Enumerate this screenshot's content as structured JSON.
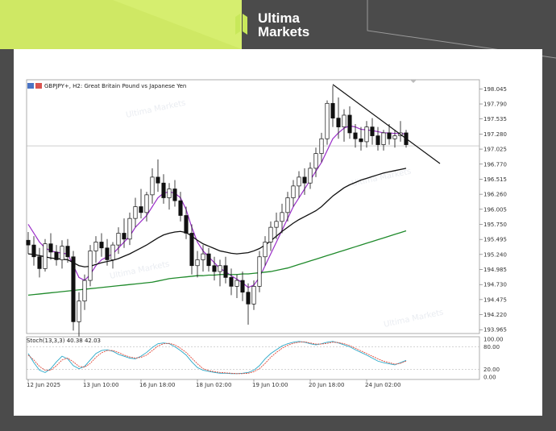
{
  "brand": {
    "line1": "Ultima",
    "line2": "Markets",
    "accent": "#d4f06a"
  },
  "chart_data": {
    "type": "candlestick",
    "symbol_title": "GBPJPY+, H2:  Great Britain Pound vs Japanese Yen",
    "indicator_title": "Stoch(13,3,3) 40.38 42.03",
    "price_axis": [
      "198.045",
      "197.790",
      "197.535",
      "197.280",
      "197.025",
      "196.770",
      "196.515",
      "196.260",
      "196.005",
      "195.750",
      "195.495",
      "195.240",
      "194.985",
      "194.730",
      "194.475",
      "194.220",
      "193.965"
    ],
    "stoch_axis": [
      "100.00",
      "80.00",
      "20.00",
      "0.00"
    ],
    "x_labels": [
      "12 Jun 2025",
      "13 Jun 10:00",
      "16 Jun 18:00",
      "18 Jun 02:00",
      "19 Jun 10:00",
      "20 Jun 18:00",
      "24 Jun 02:00"
    ],
    "ylim": [
      193.9,
      198.2
    ],
    "current_price": 197.08,
    "candles": [
      [
        195.48,
        195.62,
        195.25,
        195.4
      ],
      [
        195.4,
        195.55,
        195.05,
        195.2
      ],
      [
        195.2,
        195.35,
        194.85,
        195.0
      ],
      [
        195.0,
        195.5,
        194.95,
        195.42
      ],
      [
        195.42,
        195.6,
        195.15,
        195.28
      ],
      [
        195.28,
        195.4,
        195.05,
        195.15
      ],
      [
        195.15,
        195.48,
        195.0,
        195.38
      ],
      [
        195.38,
        195.5,
        195.1,
        195.2
      ],
      [
        195.2,
        195.3,
        193.95,
        194.1
      ],
      [
        194.1,
        194.6,
        193.85,
        194.45
      ],
      [
        194.45,
        194.9,
        194.3,
        194.8
      ],
      [
        194.8,
        195.4,
        194.7,
        195.3
      ],
      [
        195.3,
        195.55,
        195.1,
        195.45
      ],
      [
        195.45,
        195.6,
        195.2,
        195.35
      ],
      [
        195.35,
        195.5,
        195.05,
        195.15
      ],
      [
        195.15,
        195.45,
        195.0,
        195.4
      ],
      [
        195.4,
        195.7,
        195.25,
        195.6
      ],
      [
        195.6,
        195.85,
        195.35,
        195.5
      ],
      [
        195.5,
        195.95,
        195.4,
        195.85
      ],
      [
        195.85,
        196.2,
        195.7,
        196.05
      ],
      [
        196.05,
        196.35,
        195.85,
        195.95
      ],
      [
        195.95,
        196.3,
        195.8,
        196.25
      ],
      [
        196.25,
        196.7,
        196.1,
        196.55
      ],
      [
        196.55,
        196.85,
        196.3,
        196.45
      ],
      [
        196.45,
        196.6,
        196.1,
        196.2
      ],
      [
        196.2,
        196.45,
        196.0,
        196.35
      ],
      [
        196.35,
        196.5,
        196.05,
        196.15
      ],
      [
        196.15,
        196.3,
        195.8,
        195.9
      ],
      [
        195.9,
        196.05,
        195.5,
        195.6
      ],
      [
        195.6,
        195.75,
        194.9,
        195.05
      ],
      [
        195.05,
        195.3,
        194.85,
        195.15
      ],
      [
        195.15,
        195.4,
        194.95,
        195.25
      ],
      [
        195.25,
        195.35,
        194.95,
        195.05
      ],
      [
        195.05,
        195.2,
        194.8,
        194.95
      ],
      [
        194.95,
        195.15,
        194.7,
        195.05
      ],
      [
        195.05,
        195.2,
        194.75,
        194.85
      ],
      [
        194.85,
        195.0,
        194.55,
        194.7
      ],
      [
        194.7,
        194.9,
        194.5,
        194.8
      ],
      [
        194.8,
        194.95,
        194.45,
        194.6
      ],
      [
        194.6,
        194.75,
        194.05,
        194.4
      ],
      [
        194.4,
        194.8,
        194.3,
        194.7
      ],
      [
        194.7,
        195.3,
        194.6,
        195.2
      ],
      [
        195.2,
        195.55,
        195.05,
        195.45
      ],
      [
        195.45,
        195.8,
        195.3,
        195.7
      ],
      [
        195.7,
        195.95,
        195.5,
        195.8
      ],
      [
        195.8,
        196.1,
        195.6,
        195.95
      ],
      [
        195.95,
        196.3,
        195.8,
        196.2
      ],
      [
        196.2,
        196.5,
        196.05,
        196.4
      ],
      [
        196.4,
        196.65,
        196.2,
        196.55
      ],
      [
        196.55,
        196.7,
        196.25,
        196.45
      ],
      [
        196.45,
        196.8,
        196.35,
        196.7
      ],
      [
        196.7,
        197.05,
        196.55,
        196.95
      ],
      [
        196.95,
        197.3,
        196.8,
        197.2
      ],
      [
        197.2,
        197.85,
        197.1,
        197.8
      ],
      [
        197.8,
        198.1,
        197.4,
        197.55
      ],
      [
        197.55,
        197.9,
        197.2,
        197.4
      ],
      [
        197.4,
        197.7,
        197.15,
        197.6
      ],
      [
        197.6,
        197.75,
        197.2,
        197.3
      ],
      [
        197.3,
        197.45,
        197.05,
        197.2
      ],
      [
        197.2,
        197.4,
        197.0,
        197.15
      ],
      [
        197.15,
        197.5,
        197.05,
        197.4
      ],
      [
        197.4,
        197.55,
        197.1,
        197.25
      ],
      [
        197.25,
        197.4,
        197.0,
        197.1
      ],
      [
        197.1,
        197.35,
        197.0,
        197.3
      ],
      [
        197.3,
        197.45,
        197.1,
        197.2
      ],
      [
        197.2,
        197.35,
        197.05,
        197.25
      ],
      [
        197.25,
        197.5,
        197.15,
        197.3
      ],
      [
        197.3,
        197.35,
        197.05,
        197.1
      ]
    ],
    "series": [
      {
        "name": "",
        "color": "#9b2fc9",
        "values": [
          195.75,
          195.6,
          195.45,
          195.35,
          195.3,
          195.28,
          195.26,
          195.25,
          195.05,
          194.85,
          194.8,
          194.9,
          195.05,
          195.15,
          195.2,
          195.25,
          195.35,
          195.45,
          195.55,
          195.7,
          195.8,
          195.9,
          196.05,
          196.2,
          196.28,
          196.3,
          196.28,
          196.2,
          196.0,
          195.7,
          195.45,
          195.3,
          195.2,
          195.1,
          195.0,
          194.95,
          194.88,
          194.82,
          194.76,
          194.68,
          194.72,
          194.85,
          195.05,
          195.25,
          195.45,
          195.65,
          195.85,
          196.05,
          196.2,
          196.35,
          196.5,
          196.65,
          196.8,
          197.0,
          197.2,
          197.3,
          197.38,
          197.42,
          197.4,
          197.36,
          197.35,
          197.34,
          197.32,
          197.3,
          197.3,
          197.29,
          197.29,
          197.28
        ]
      },
      {
        "name": "",
        "color": "#111111",
        "values": [
          195.25,
          195.24,
          195.22,
          195.2,
          195.18,
          195.17,
          195.16,
          195.15,
          195.1,
          195.05,
          195.03,
          195.04,
          195.07,
          195.1,
          195.12,
          195.14,
          195.17,
          195.21,
          195.25,
          195.3,
          195.35,
          195.4,
          195.46,
          195.52,
          195.57,
          195.6,
          195.62,
          195.63,
          195.61,
          195.55,
          195.48,
          195.42,
          195.38,
          195.34,
          195.3,
          195.28,
          195.26,
          195.25,
          195.26,
          195.27,
          195.3,
          195.34,
          195.4,
          195.47,
          195.55,
          195.63,
          195.7,
          195.77,
          195.83,
          195.88,
          195.93,
          195.98,
          196.05,
          196.14,
          196.23,
          196.3,
          196.37,
          196.42,
          196.46,
          196.5,
          196.53,
          196.56,
          196.59,
          196.62,
          196.64,
          196.66,
          196.68,
          196.7
        ]
      },
      {
        "name": "",
        "color": "#1f8a2b",
        "values": [
          194.55,
          194.56,
          194.57,
          194.58,
          194.59,
          194.6,
          194.61,
          194.62,
          194.63,
          194.64,
          194.65,
          194.66,
          194.67,
          194.68,
          194.69,
          194.7,
          194.71,
          194.72,
          194.73,
          194.74,
          194.75,
          194.76,
          194.77,
          194.79,
          194.81,
          194.83,
          194.84,
          194.85,
          194.86,
          194.87,
          194.88,
          194.88,
          194.89,
          194.89,
          194.9,
          194.9,
          194.9,
          194.9,
          194.91,
          194.91,
          194.92,
          194.93,
          194.94,
          194.95,
          194.97,
          194.99,
          195.01,
          195.04,
          195.07,
          195.1,
          195.13,
          195.16,
          195.19,
          195.22,
          195.25,
          195.28,
          195.31,
          195.34,
          195.37,
          195.4,
          195.43,
          195.46,
          195.49,
          195.52,
          195.55,
          195.58,
          195.61,
          195.64
        ]
      }
    ],
    "trendline": {
      "start": [
        54,
        198.12
      ],
      "end": [
        73,
        196.78
      ],
      "color": "#111111"
    },
    "stoch_k": [
      62,
      38,
      18,
      12,
      22,
      40,
      55,
      48,
      30,
      22,
      28,
      45,
      62,
      70,
      72,
      68,
      60,
      55,
      50,
      48,
      55,
      65,
      78,
      88,
      90,
      88,
      80,
      70,
      58,
      40,
      25,
      18,
      15,
      12,
      10,
      10,
      9,
      9,
      10,
      12,
      18,
      30,
      48,
      62,
      72,
      82,
      88,
      92,
      94,
      92,
      88,
      85,
      88,
      92,
      94,
      90,
      85,
      80,
      72,
      65,
      58,
      50,
      42,
      38,
      35,
      32,
      38,
      44
    ],
    "stoch_d": [
      58,
      45,
      28,
      18,
      18,
      30,
      45,
      50,
      40,
      28,
      26,
      36,
      52,
      64,
      70,
      70,
      65,
      58,
      53,
      50,
      52,
      58,
      70,
      82,
      88,
      89,
      85,
      76,
      65,
      50,
      35,
      22,
      17,
      14,
      12,
      11,
      10,
      9,
      9,
      10,
      14,
      22,
      36,
      52,
      65,
      76,
      84,
      89,
      92,
      93,
      90,
      87,
      87,
      89,
      92,
      91,
      88,
      83,
      76,
      69,
      62,
      55,
      48,
      42,
      38,
      34,
      36,
      42
    ]
  }
}
